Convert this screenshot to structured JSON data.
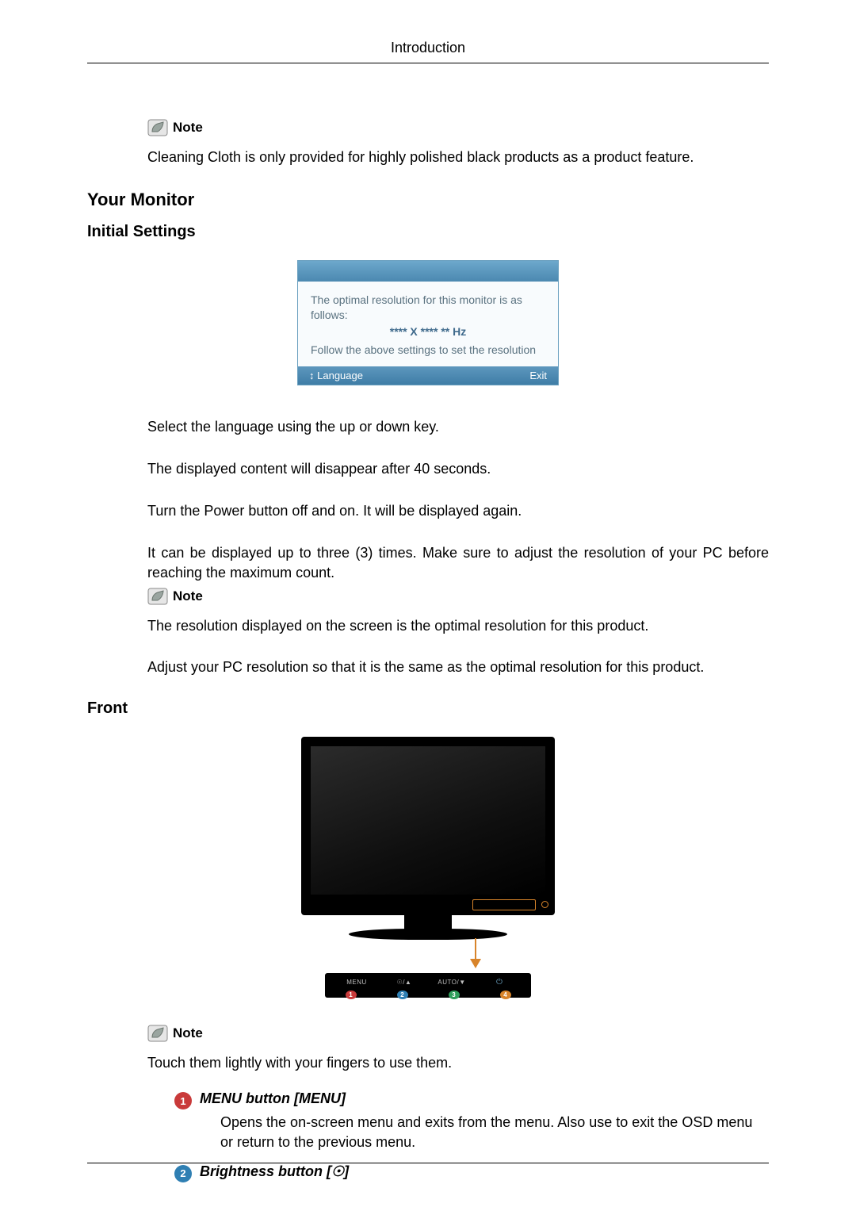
{
  "header": {
    "title": "Introduction"
  },
  "note_label": "Note",
  "section1": {
    "para1": "Cleaning Cloth is only provided for highly polished black products as a product feature."
  },
  "your_monitor": {
    "heading": "Your Monitor",
    "subheading": "Initial Settings"
  },
  "osd": {
    "line1": "The optimal resolution for this monitor is as follows:",
    "line2": "**** X **** ** Hz",
    "line3": "Follow the above settings to set the resolution",
    "lang_label": "Language",
    "exit_label": "Exit"
  },
  "initial": {
    "p1": "Select the language using the up or down key.",
    "p2": "The displayed content will disappear after 40 seconds.",
    "p3": "Turn the Power button off and on. It will be displayed again.",
    "p4": "It can be displayed up to three (3) times. Make sure to adjust the resolution of your PC before reaching the maximum count.",
    "p5": "The resolution displayed on the screen is the optimal resolution for this product.",
    "p6": "Adjust your PC resolution so that it is the same as the optimal resolution for this product."
  },
  "front": {
    "heading": "Front",
    "touch_note": "Touch them lightly with your fingers to use them.",
    "buttons": {
      "b1": "MENU",
      "b2": "☉/▲",
      "b3": "AUTO/▼",
      "b4": "⏻"
    },
    "items": {
      "i1": {
        "title": "MENU button [MENU]",
        "desc": "Opens the on-screen menu and exits from the menu. Also use to exit the OSD menu or return to the previous menu."
      },
      "i2": {
        "title": "Brightness button [☉]"
      }
    }
  }
}
